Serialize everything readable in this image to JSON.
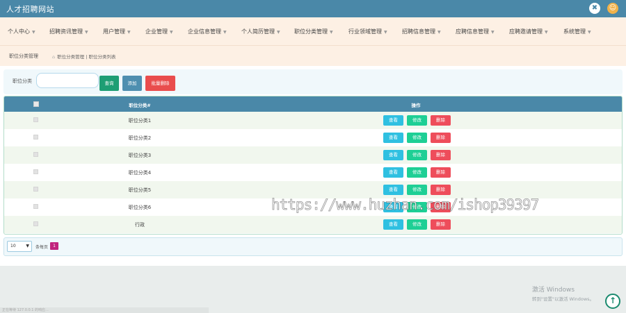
{
  "app": {
    "title": "人才招聘网站",
    "settings_icon": "✖",
    "avatar_icon": "☺"
  },
  "menu": [
    {
      "label": "个人中心"
    },
    {
      "label": "招聘资讯管理"
    },
    {
      "label": "用户管理"
    },
    {
      "label": "企业管理"
    },
    {
      "label": "企业信息管理"
    },
    {
      "label": "个人简历管理"
    },
    {
      "label": "职位分类管理"
    },
    {
      "label": "行业领域管理"
    },
    {
      "label": "招聘信息管理"
    },
    {
      "label": "应聘信息管理"
    },
    {
      "label": "应聘邀请管理"
    },
    {
      "label": "系统管理"
    }
  ],
  "breadcrumb": {
    "title": "职位分类管理",
    "path": "职位分类管理 | 职位分类列表"
  },
  "search": {
    "label": "职位分类",
    "value": "",
    "search_label": "查询",
    "add_label": "添加",
    "batch_delete_label": "批量删除"
  },
  "table": {
    "header": {
      "name": "职位分类#",
      "ops": "操作"
    },
    "rows": [
      {
        "name": "职位分类1"
      },
      {
        "name": "职位分类2"
      },
      {
        "name": "职位分类3"
      },
      {
        "name": "职位分类4"
      },
      {
        "name": "职位分类5"
      },
      {
        "name": "职位分类6"
      },
      {
        "name": "行政"
      }
    ],
    "ops": {
      "view": "查看",
      "edit": "修改",
      "delete": "删除"
    }
  },
  "pager": {
    "size": "10",
    "per_page_label": "条每页",
    "current_page": "1"
  },
  "watermark": "https://www.huzhan.com/ishop39397",
  "activation": {
    "line1": "激活 Windows",
    "line2": "转到\"设置\"以激活 Windows。"
  },
  "status": "正在等待 127.0.0.1 的响应...",
  "colors": {
    "header": "#4a88a8",
    "menu_bg": "#fdf0e4",
    "view": "#2fc0e1",
    "edit": "#1ecf95",
    "delete": "#ee4d5b"
  }
}
